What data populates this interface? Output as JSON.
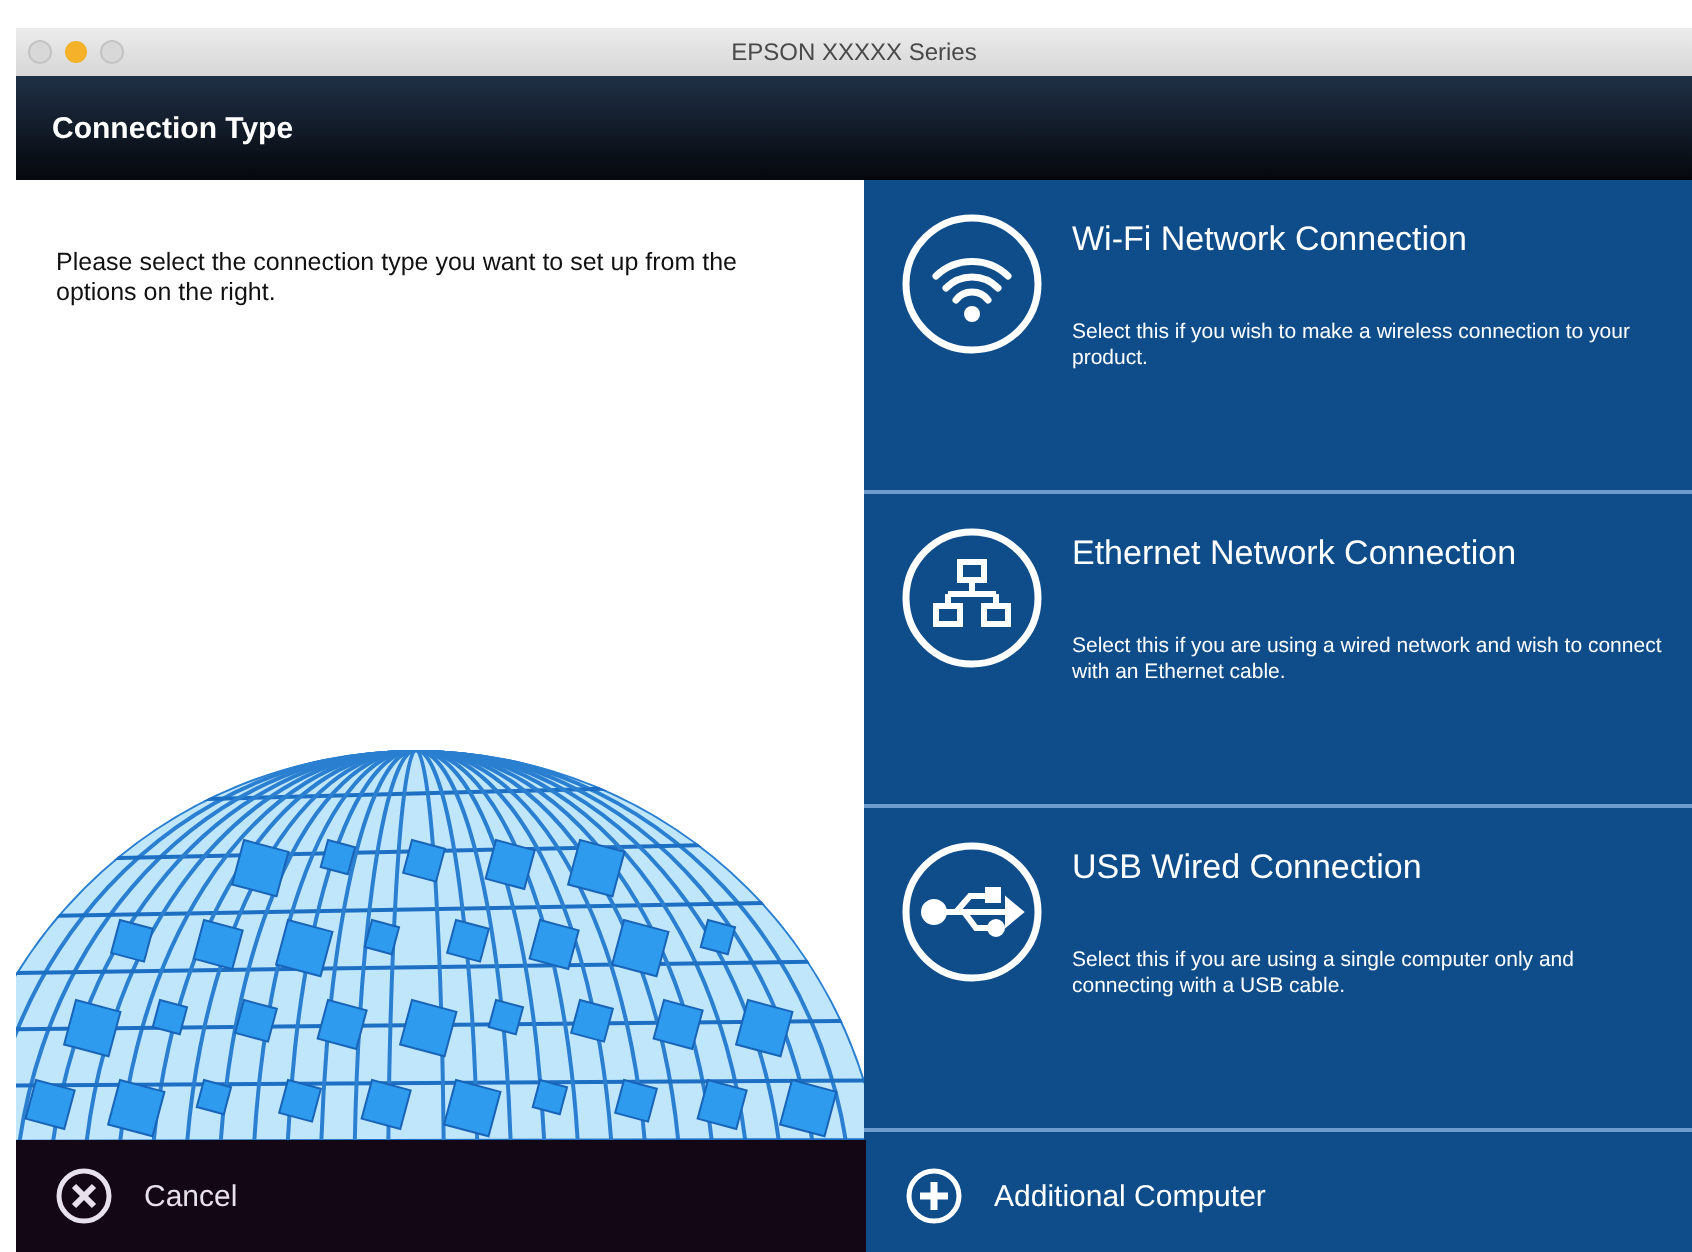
{
  "window": {
    "title": "EPSON XXXXX Series"
  },
  "header": {
    "title": "Connection Type"
  },
  "instructions": "Please select the connection type you want to set up from the options on the right.",
  "options": [
    {
      "kind": "wifi",
      "title": "Wi-Fi Network Connection",
      "description": "Select this if you wish to make a wireless connection to your product."
    },
    {
      "kind": "ethernet",
      "title": "Ethernet Network Connection",
      "description": "Select this if you are using a wired network and wish to connect with an Ethernet cable."
    },
    {
      "kind": "usb",
      "title": "USB Wired Connection",
      "description": "Select this if you are using a single computer only and connecting with a USB cable."
    }
  ],
  "footer": {
    "cancel": "Cancel",
    "additional": "Additional Computer"
  }
}
